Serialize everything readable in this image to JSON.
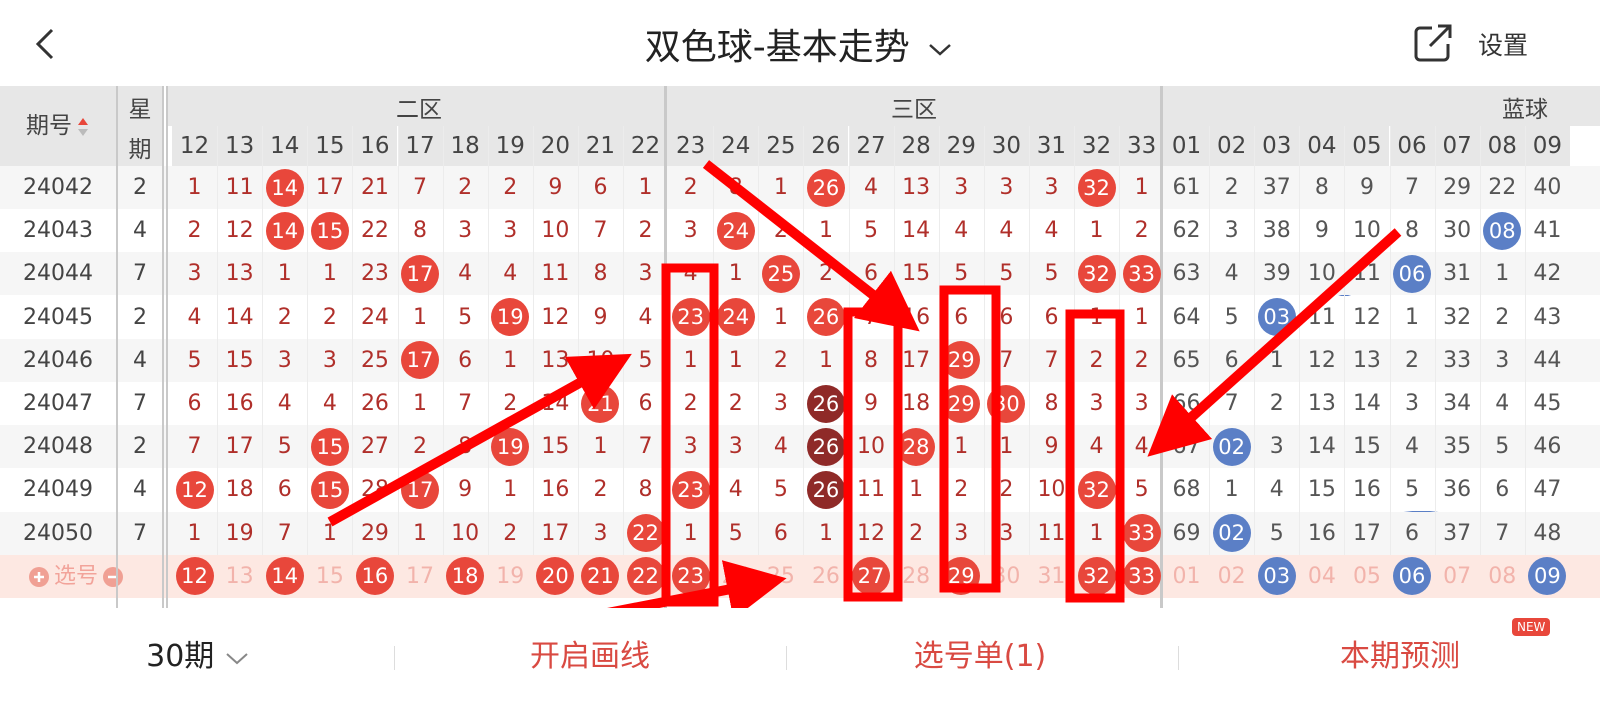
{
  "header": {
    "title": "双色球-基本走势",
    "settings_label": "设置",
    "icons": {
      "back": "back-icon",
      "dropdown": "chevron-down-icon",
      "share": "share-icon"
    }
  },
  "table": {
    "col_period": "期号",
    "col_week_top": "星",
    "col_week_bottom": "期",
    "zones": [
      "二区",
      "三区",
      "蓝球"
    ],
    "red_columns": [
      "12",
      "13",
      "14",
      "15",
      "16",
      "17",
      "18",
      "19",
      "20",
      "21",
      "22",
      "23",
      "24",
      "25",
      "26",
      "27",
      "28",
      "29",
      "30",
      "31",
      "32",
      "33"
    ],
    "blue_columns": [
      "01",
      "02",
      "03",
      "04",
      "05",
      "06",
      "07",
      "08",
      "09"
    ],
    "rows": [
      {
        "period": "24042",
        "week": "2",
        "red": [
          "1",
          "11",
          "14",
          "17",
          "21",
          "7",
          "2",
          "2",
          "9",
          "6",
          "1",
          "2",
          "8",
          "1",
          "26",
          "4",
          "13",
          "3",
          "3",
          "3",
          "32",
          "1"
        ],
        "blue": [
          "61",
          "2",
          "37",
          "8",
          "9",
          "7",
          "29",
          "22",
          "40"
        ],
        "red_hits": [
          "14",
          "26",
          "32"
        ],
        "dark_hits": [],
        "blue_hits": []
      },
      {
        "period": "24043",
        "week": "4",
        "red": [
          "2",
          "12",
          "14",
          "15",
          "22",
          "8",
          "3",
          "3",
          "10",
          "7",
          "2",
          "3",
          "24",
          "2",
          "1",
          "5",
          "14",
          "4",
          "4",
          "4",
          "1",
          "2"
        ],
        "blue": [
          "62",
          "3",
          "38",
          "9",
          "10",
          "8",
          "30",
          "08",
          "41"
        ],
        "red_hits": [
          "14",
          "15",
          "24"
        ],
        "dark_hits": [],
        "blue_hits": [
          "08"
        ]
      },
      {
        "period": "24044",
        "week": "7",
        "red": [
          "3",
          "13",
          "1",
          "1",
          "23",
          "17",
          "4",
          "4",
          "11",
          "8",
          "3",
          "4",
          "1",
          "25",
          "2",
          "6",
          "15",
          "5",
          "5",
          "5",
          "32",
          "33"
        ],
        "blue": [
          "63",
          "4",
          "39",
          "10",
          "11",
          "06",
          "31",
          "1",
          "42"
        ],
        "red_hits": [
          "17",
          "25",
          "32",
          "33"
        ],
        "dark_hits": [],
        "blue_hits": [
          "06"
        ]
      },
      {
        "period": "24045",
        "week": "2",
        "red": [
          "4",
          "14",
          "2",
          "2",
          "24",
          "1",
          "5",
          "19",
          "12",
          "9",
          "4",
          "23",
          "24",
          "1",
          "26",
          "7",
          "16",
          "6",
          "6",
          "6",
          "1",
          "1"
        ],
        "blue": [
          "64",
          "5",
          "03",
          "11",
          "12",
          "1",
          "32",
          "2",
          "43"
        ],
        "red_hits": [
          "19",
          "23",
          "24",
          "26"
        ],
        "dark_hits": [],
        "blue_hits": [
          "03"
        ]
      },
      {
        "period": "24046",
        "week": "4",
        "red": [
          "5",
          "15",
          "3",
          "3",
          "25",
          "17",
          "6",
          "1",
          "13",
          "10",
          "5",
          "1",
          "1",
          "2",
          "1",
          "8",
          "17",
          "29",
          "7",
          "7",
          "2",
          "2"
        ],
        "blue": [
          "65",
          "6",
          "1",
          "12",
          "13",
          "2",
          "33",
          "3",
          "44"
        ],
        "red_hits": [
          "17",
          "29"
        ],
        "dark_hits": [],
        "blue_hits": []
      },
      {
        "period": "24047",
        "week": "7",
        "red": [
          "6",
          "16",
          "4",
          "4",
          "26",
          "1",
          "7",
          "2",
          "14",
          "21",
          "6",
          "2",
          "2",
          "3",
          "26",
          "9",
          "18",
          "29",
          "30",
          "8",
          "3",
          "3"
        ],
        "blue": [
          "66",
          "7",
          "2",
          "13",
          "14",
          "3",
          "34",
          "4",
          "45"
        ],
        "red_hits": [
          "21",
          "29",
          "30"
        ],
        "dark_hits": [
          "26"
        ],
        "blue_hits": []
      },
      {
        "period": "24048",
        "week": "2",
        "red": [
          "7",
          "17",
          "5",
          "15",
          "27",
          "2",
          "8",
          "19",
          "15",
          "1",
          "7",
          "3",
          "3",
          "4",
          "26",
          "10",
          "28",
          "1",
          "1",
          "9",
          "4",
          "4"
        ],
        "blue": [
          "67",
          "02",
          "3",
          "14",
          "15",
          "4",
          "35",
          "5",
          "46"
        ],
        "red_hits": [
          "15",
          "19",
          "28"
        ],
        "dark_hits": [
          "26"
        ],
        "blue_hits": [
          "02"
        ]
      },
      {
        "period": "24049",
        "week": "4",
        "red": [
          "12",
          "18",
          "6",
          "15",
          "28",
          "17",
          "9",
          "1",
          "16",
          "2",
          "8",
          "23",
          "4",
          "5",
          "26",
          "11",
          "1",
          "2",
          "2",
          "10",
          "32",
          "5"
        ],
        "blue": [
          "68",
          "1",
          "4",
          "15",
          "16",
          "5",
          "36",
          "6",
          "47"
        ],
        "red_hits": [
          "12",
          "15",
          "17",
          "23",
          "32"
        ],
        "dark_hits": [
          "26"
        ],
        "blue_hits": []
      },
      {
        "period": "24050",
        "week": "7",
        "red": [
          "1",
          "19",
          "7",
          "1",
          "29",
          "1",
          "10",
          "2",
          "17",
          "3",
          "22",
          "1",
          "5",
          "6",
          "1",
          "12",
          "2",
          "3",
          "3",
          "11",
          "1",
          "33"
        ],
        "blue": [
          "69",
          "02",
          "5",
          "16",
          "17",
          "6",
          "37",
          "7",
          "48"
        ],
        "red_hits": [
          "22",
          "33"
        ],
        "dark_hits": [],
        "blue_hits": [
          "02"
        ]
      }
    ],
    "select_row": {
      "label": "选号",
      "add_icon": "plus-circle-icon",
      "remove_icon": "minus-circle-icon",
      "selected_red": [
        "12",
        "14",
        "16",
        "18",
        "20",
        "21",
        "22",
        "23",
        "27",
        "29",
        "32",
        "33"
      ],
      "selected_blue": [
        "03",
        "06",
        "09"
      ]
    }
  },
  "footer": {
    "period_count": "30期",
    "draw_lines": "开启画线",
    "selection_list": "选号单(1)",
    "prediction": "本期预测",
    "new_badge": "NEW"
  },
  "colors": {
    "red_ball": "#e8473b",
    "dark_ball": "#8f2a28",
    "blue_ball": "#5b7fc6",
    "red_text": "#b02f2a",
    "annotation": "#ff0000",
    "highlight_row": "#fde8e2"
  }
}
